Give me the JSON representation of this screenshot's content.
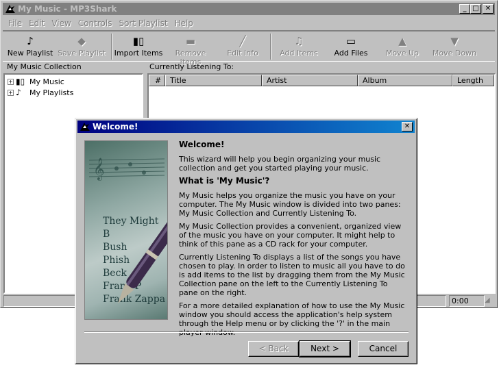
{
  "app": {
    "title": "My Music - MP3Shark",
    "window_buttons": {
      "minimize": "_",
      "maximize": "□",
      "close": "✕"
    }
  },
  "menu": [
    "File",
    "Edit",
    "View",
    "Controls",
    "Sort Playlist",
    "Help"
  ],
  "toolbar": {
    "new_playlist": "New Playlist",
    "save_playlist": "Save Playlist",
    "import_items": "Import Items",
    "remove_items": "Remove Items",
    "edit_info": "Edit Info",
    "add_items": "Add Items",
    "add_files": "Add Files",
    "move_up": "Move Up",
    "move_down": "Move Down"
  },
  "collection": {
    "label": "My Music Collection",
    "items": [
      {
        "label": "My Music",
        "expander": "+"
      },
      {
        "label": "My Playlists",
        "expander": "+"
      }
    ]
  },
  "listening": {
    "label": "Currently Listening To:",
    "columns": [
      "#",
      "Title",
      "Artist",
      "Album",
      "Length"
    ]
  },
  "status": {
    "time": "0:00"
  },
  "dialog": {
    "title": "Welcome!",
    "close": "✕",
    "heading": "Welcome!",
    "intro": "This wizard will help you begin organizing your music collection and get you started playing your music.",
    "subheading": "What is 'My Music'?",
    "para1": "My Music helps you organize the music you have on your computer. The My Music window is divided into two panes: My Music Collection and Currently Listening To.",
    "para2": "My Music Collection provides a convenient, organized view of the music you have on your computer. It might help to think of this pane as a CD rack for your computer.",
    "para3": "Currently Listening To displays a list of the songs you have chosen to play. In order to listen to music all you have to do is add items to the list by dragging them from the My Music Collection pane on the left to the Currently Listening To pane on the right.",
    "para4": "For a more detailed explanation of how to use the My Music window you should access the application's help system through the Help menu or by clicking the '?' in the main player window.",
    "banner_names": [
      "They Might B",
      "Bush",
      "Phish",
      "Beck",
      "Frank P",
      "Frank Zappa"
    ],
    "back": "< Back",
    "next": "Next >",
    "cancel": "Cancel"
  }
}
